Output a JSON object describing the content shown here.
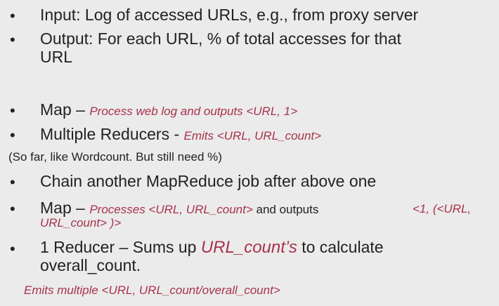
{
  "bullets": {
    "b1": {
      "text": "Input: Log of accessed URLs, e.g., from proxy server"
    },
    "b2": {
      "text_line1": "Output: For each URL, % of total accesses for that",
      "text_line2": "URL"
    },
    "b3": {
      "main": "Map – ",
      "detail": "Process web log and outputs <URL, 1>"
    },
    "b4": {
      "main": "Multiple Reducers - ",
      "detail": "Emits <URL, URL_count>"
    },
    "note": "(So far, like Wordcount. But still need %)",
    "b5": {
      "text": "Chain another MapReduce job after above one"
    },
    "b6": {
      "main": "Map – ",
      "detail1": "Processes <URL, URL_count>",
      "middle": " and outputs",
      "detail2": "<1, (<URL,",
      "detail3": "URL_count> )>"
    },
    "b7": {
      "main1": "1 Reducer – Sums up ",
      "highlight": "URL_count’s",
      "main2": " to calculate",
      "line2": "overall_count."
    },
    "footer": "Emits multiple <URL, URL_count/overall_count>"
  },
  "bullet_glyph": "•",
  "colors": {
    "background": "#ebebeb",
    "text": "#222222",
    "accent_red": "#a8324c"
  }
}
